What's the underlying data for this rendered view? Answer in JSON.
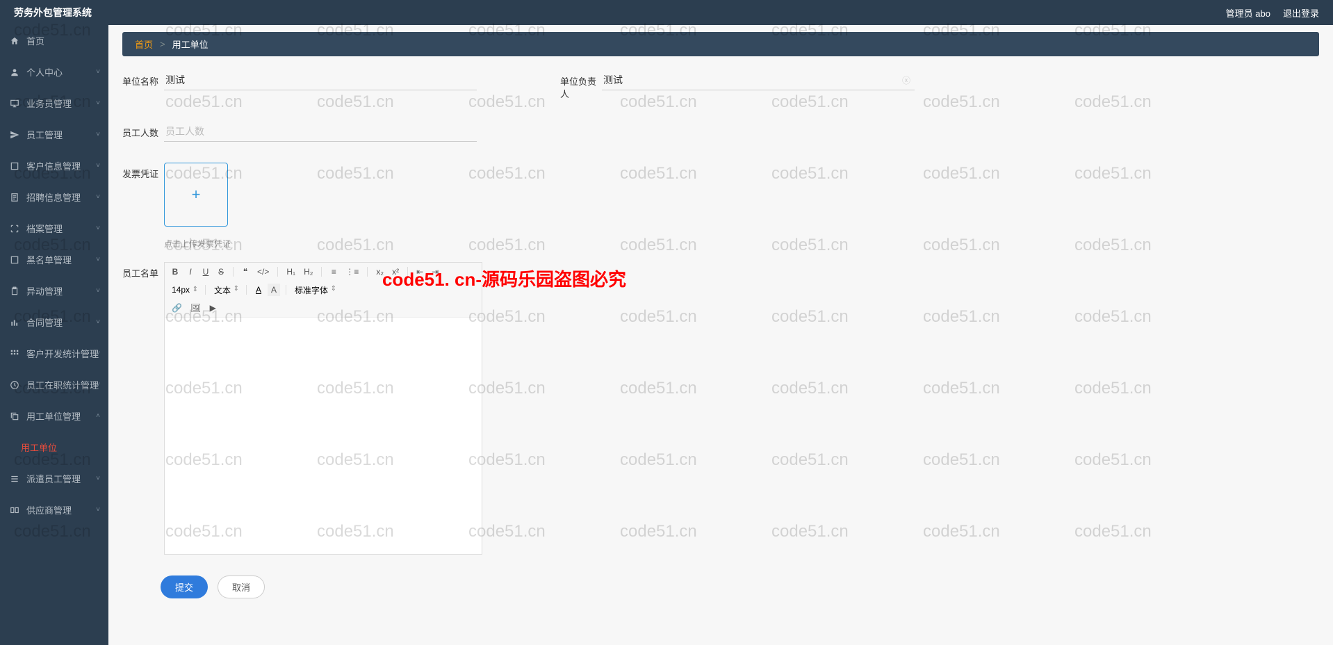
{
  "header": {
    "title": "劳务外包管理系统",
    "admin": "管理员 abo",
    "logout": "退出登录"
  },
  "sidebar": {
    "items": [
      {
        "icon": "home",
        "label": "首页",
        "expandable": false
      },
      {
        "icon": "user",
        "label": "个人中心",
        "expandable": true
      },
      {
        "icon": "desktop",
        "label": "业务员管理",
        "expandable": true
      },
      {
        "icon": "send",
        "label": "员工管理",
        "expandable": true
      },
      {
        "icon": "frame",
        "label": "客户信息管理",
        "expandable": true
      },
      {
        "icon": "doc",
        "label": "招聘信息管理",
        "expandable": true
      },
      {
        "icon": "scan",
        "label": "档案管理",
        "expandable": true
      },
      {
        "icon": "frame",
        "label": "黑名单管理",
        "expandable": true
      },
      {
        "icon": "clipboard",
        "label": "异动管理",
        "expandable": true
      },
      {
        "icon": "bar",
        "label": "合同管理",
        "expandable": true
      },
      {
        "icon": "grid",
        "label": "客户开发统计管理",
        "expandable": true
      },
      {
        "icon": "clock",
        "label": "员工在职统计管理",
        "expandable": true
      },
      {
        "icon": "copy",
        "label": "用工单位管理",
        "expandable": true,
        "expanded": true,
        "children": [
          {
            "label": "用工单位",
            "active": true
          }
        ]
      },
      {
        "icon": "menu",
        "label": "派遣员工管理",
        "expandable": true
      },
      {
        "icon": "cards",
        "label": "供应商管理",
        "expandable": true
      }
    ]
  },
  "breadcrumb": {
    "home": "首页",
    "sep": ">",
    "current": "用工单位"
  },
  "form": {
    "unit_name_label": "单位名称",
    "unit_name_value": "测试",
    "unit_owner_label": "单位负责人",
    "unit_owner_value": "测试",
    "emp_count_label": "员工人数",
    "emp_count_placeholder": "员工人数",
    "invoice_label": "发票凭证",
    "upload_hint": "点击上传发票凭证",
    "emp_list_label": "员工名单"
  },
  "editor": {
    "font_size": "14px",
    "text_type": "文本",
    "font_family": "标准字体"
  },
  "buttons": {
    "submit": "提交",
    "cancel": "取消"
  },
  "watermark": {
    "text": "code51.cn",
    "red": "code51. cn-源码乐园盗图必究"
  }
}
